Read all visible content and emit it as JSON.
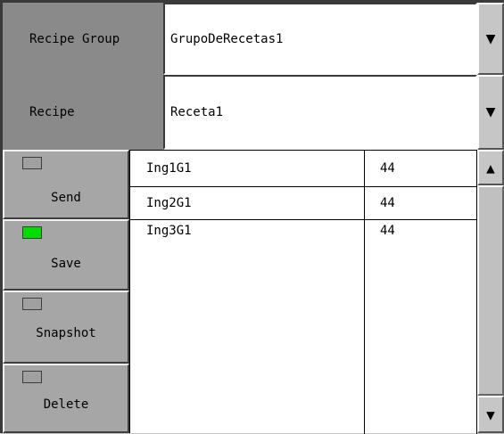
{
  "recipe_group": {
    "label": "Recipe Group",
    "value": "GrupoDeRecetas1",
    "dropdown_glyph": "▼"
  },
  "recipe": {
    "label": "Recipe",
    "value": "Receta1",
    "dropdown_glyph": "▼"
  },
  "buttons": {
    "send": {
      "label": "Send",
      "led": "off"
    },
    "save": {
      "label": "Save",
      "led": "on"
    },
    "snapshot": {
      "label": "Snapshot",
      "led": "off"
    },
    "delete": {
      "label": "Delete",
      "led": "off"
    }
  },
  "table": {
    "rows": [
      {
        "name": "Ing1G1",
        "value": "44"
      },
      {
        "name": "Ing2G1",
        "value": "44"
      },
      {
        "name": "Ing3G1",
        "value": "44"
      }
    ]
  },
  "scrollbar": {
    "up_glyph": "▲",
    "down_glyph": "▼"
  },
  "colors": {
    "led_on": "#00dd00",
    "led_off": "#a0a0a0",
    "label_bg": "#8a8a8a"
  }
}
